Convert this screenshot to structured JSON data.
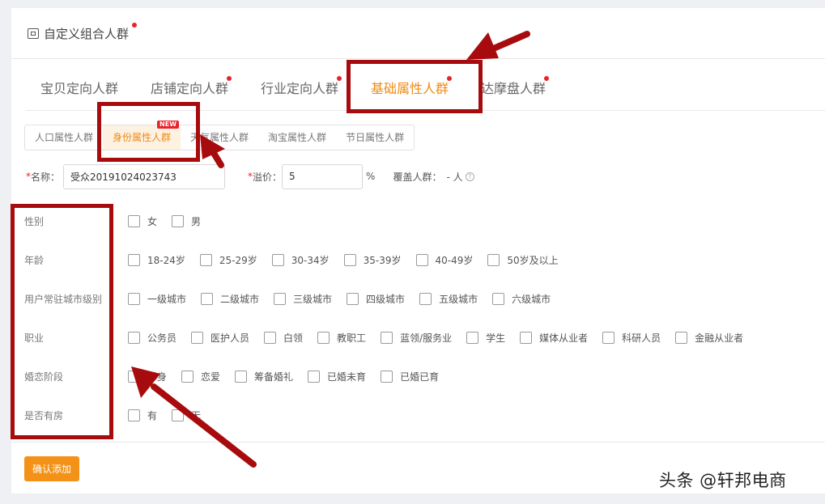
{
  "panel": {
    "title": "自定义组合人群"
  },
  "tabs": [
    {
      "label": "宝贝定向人群",
      "dot": false,
      "active": false
    },
    {
      "label": "店铺定向人群",
      "dot": true,
      "active": false
    },
    {
      "label": "行业定向人群",
      "dot": true,
      "active": false
    },
    {
      "label": "基础属性人群",
      "dot": true,
      "active": true
    },
    {
      "label": "达摩盘人群",
      "dot": true,
      "active": false
    }
  ],
  "subtabs": [
    {
      "label": "人口属性人群",
      "active": false
    },
    {
      "label": "身份属性人群",
      "active": true,
      "badge": "NEW"
    },
    {
      "label": "天气属性人群",
      "active": false
    },
    {
      "label": "淘宝属性人群",
      "active": false
    },
    {
      "label": "节日属性人群",
      "active": false
    }
  ],
  "form": {
    "name_label": "名称：",
    "name_value": "受众20191024023743",
    "premium_label": "溢价：",
    "premium_value": "5",
    "premium_unit": "%",
    "coverage_label": "覆盖人群：",
    "coverage_value": "- 人"
  },
  "attributes": [
    {
      "label": "性别",
      "options": [
        "女",
        "男"
      ]
    },
    {
      "label": "年龄",
      "options": [
        "18-24岁",
        "25-29岁",
        "30-34岁",
        "35-39岁",
        "40-49岁",
        "50岁及以上"
      ]
    },
    {
      "label": "用户常驻城市级别",
      "options": [
        "一级城市",
        "二级城市",
        "三级城市",
        "四级城市",
        "五级城市",
        "六级城市"
      ]
    },
    {
      "label": "职业",
      "options": [
        "公务员",
        "医护人员",
        "白领",
        "教职工",
        "蓝领/服务业",
        "学生",
        "媒体从业者",
        "科研人员",
        "金融从业者"
      ]
    },
    {
      "label": "婚恋阶段",
      "options": [
        "单身",
        "恋爱",
        "筹备婚礼",
        "已婚未育",
        "已婚已育"
      ]
    },
    {
      "label": "是否有房",
      "options": [
        "有",
        "无"
      ]
    }
  ],
  "footer": {
    "confirm_label": "确认添加"
  },
  "watermark": "头条 @轩邦电商",
  "colors": {
    "accent": "#ef8a14",
    "annotation": "#a70b0d",
    "dot": "#e8232a"
  }
}
